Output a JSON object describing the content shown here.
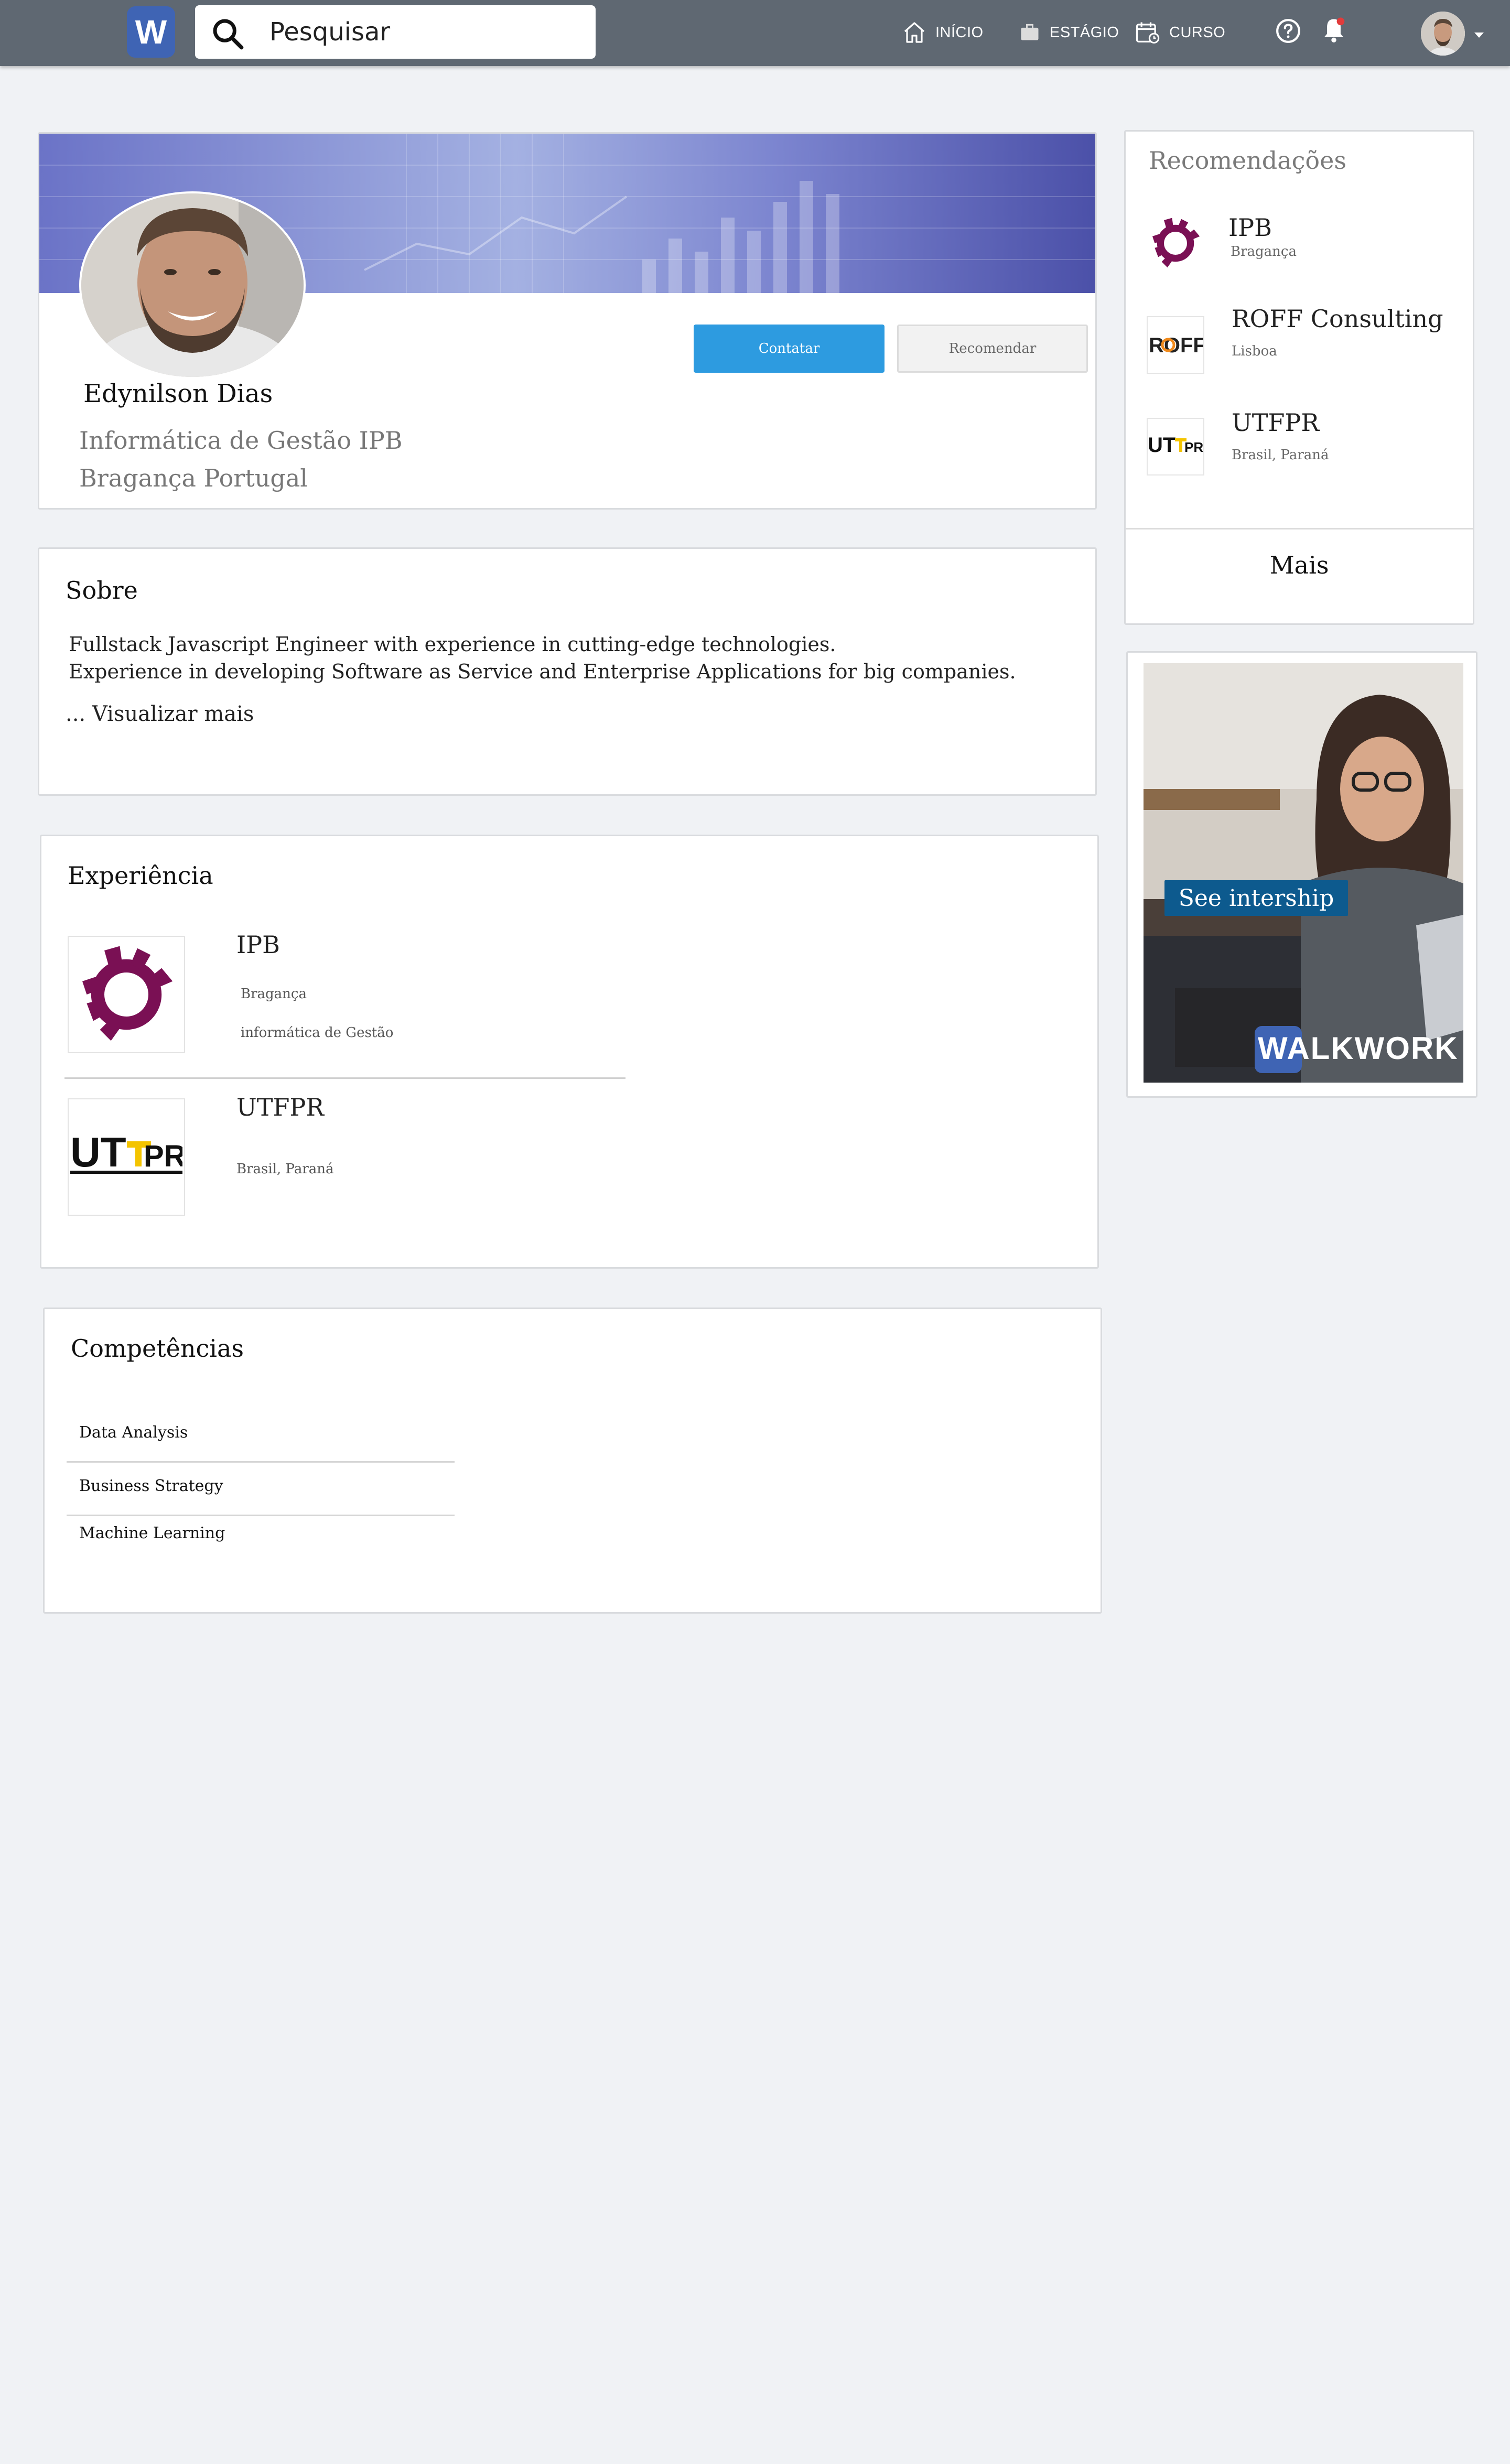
{
  "header": {
    "logo_letter": "W",
    "search_placeholder": "Pesquisar",
    "nav": [
      {
        "label": "INÍCIO",
        "icon": "home-icon"
      },
      {
        "label": "ESTÁGIO",
        "icon": "briefcase-icon"
      },
      {
        "label": "CURSO",
        "icon": "calendar-icon"
      }
    ],
    "icons": [
      "help-icon",
      "bell-icon",
      "avatar",
      "caret-down-icon"
    ]
  },
  "profile": {
    "name": "Edynilson Dias",
    "course": "Informática de Gestão IPB",
    "location": "Bragança Portugal",
    "contact_label": "Contatar",
    "recommend_label": "Recomendar"
  },
  "about": {
    "title": "Sobre",
    "line1": "Fullstack Javascript Engineer with experience in cutting-edge technologies.",
    "line2": "Experience in developing Software as Service and Enterprise Applications for big companies.",
    "more": "... Visualizar mais"
  },
  "experience": {
    "title": "Experiência",
    "items": [
      {
        "name": "IPB",
        "location": "Bragança",
        "role": "informática de Gestão"
      },
      {
        "name": "UTFPR",
        "location": "Brasil, Paraná"
      }
    ]
  },
  "skills": {
    "title": "Competências",
    "items": [
      "Data Analysis",
      "Business Strategy",
      "Machine Learning"
    ]
  },
  "recommendations": {
    "title": "Recomendações",
    "items": [
      {
        "name": "IPB",
        "sub": "Bragança"
      },
      {
        "name": "ROFF Consulting",
        "sub": "Lisboa",
        "logo_text": "ROFF"
      },
      {
        "name": "UTFPR",
        "sub": "Brasil, Paraná",
        "logo_text": "UTFPR"
      }
    ],
    "more": "Mais"
  },
  "ad": {
    "cta": "See intership",
    "brand": "WALKWORK"
  },
  "colors": {
    "topbar": "#5f6872",
    "primary_button": "#2d9be0",
    "brand_blue": "#3f64b4",
    "ipb_purple": "#7a1054"
  }
}
